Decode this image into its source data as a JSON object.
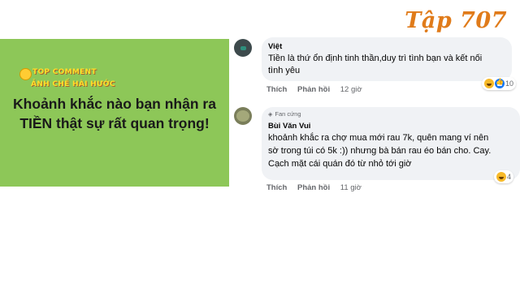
{
  "episode_label": "Tập 707",
  "brand": {
    "line1": "TOP COMMENT",
    "line2": "ẢNH CHẾ HÀI HƯỚC"
  },
  "headline": {
    "line1": "Khoảnh khắc nào bạn nhận ra",
    "line2": "TIỀN thật sự rất quan trọng!"
  },
  "comments": [
    {
      "author": "Việt",
      "text_line1": "Tiền là thứ ổn định tinh thần,duy trì tình bạn và kết nối",
      "text_line2": "tình yêu",
      "like_label": "Thích",
      "reply_label": "Phản hồi",
      "time": "12 giờ",
      "reaction_count": "10"
    },
    {
      "badge": "Fan cứng",
      "author": "Bùi Văn Vui",
      "text_line1": "khoảnh khắc ra chợ mua mới rau 7k, quên mang ví nên",
      "text_line2": "sờ trong túi có 5k :)) nhưng bà bán rau éo bán cho. Cay.",
      "text_line3": "Cạch mặt cái quán đó từ nhỏ tới giờ",
      "like_label": "Thích",
      "reply_label": "Phản hồi",
      "time": "11 giờ",
      "reaction_count": "4"
    }
  ],
  "colors": {
    "panel_green": "#8dc758",
    "episode_orange": "#e07b1a",
    "brand_yellow": "#ffdf29"
  }
}
